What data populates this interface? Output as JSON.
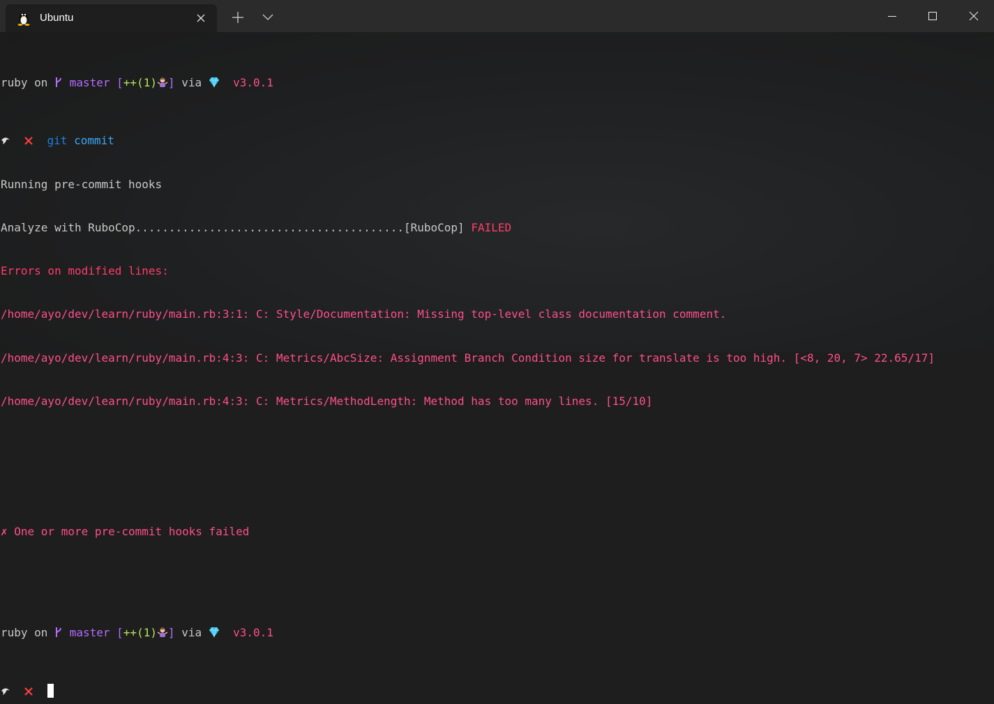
{
  "window": {
    "tab_title": "Ubuntu",
    "tab_icon": "linux-penguin-icon",
    "new_tab_icon": "plus-icon",
    "dropdown_icon": "chevron-down-icon"
  },
  "prompt": {
    "dir": "ruby",
    "on": "on",
    "branch_icon": "git-branch-icon",
    "branch": "master",
    "status_open": "[",
    "status_plus": "++(1)",
    "status_close": "]",
    "status_emoji": "person-shrugging-emoji",
    "via": "via",
    "ruby_icon": "ruby-gem-icon",
    "version": "v3.0.1",
    "shell_icon": "shell-icon",
    "error_icon": "cross-mark-icon"
  },
  "command": {
    "git": "git",
    "commit": "commit"
  },
  "output": {
    "running": "Running pre-commit hooks",
    "analyze": "Analyze with RuboCop........................................",
    "analyze_tag": "[RuboCop]",
    "failed": "FAILED",
    "errors_header": "Errors on modified lines:",
    "error_lines": [
      "/home/ayo/dev/learn/ruby/main.rb:3:1: C: Style/Documentation: Missing top-level class documentation comment.",
      "/home/ayo/dev/learn/ruby/main.rb:4:3: C: Metrics/AbcSize: Assignment Branch Condition size for translate is too high. [<8, 20, 7> 22.65/17]",
      "/home/ayo/dev/learn/ruby/main.rb:4:3: C: Metrics/MethodLength: Method has too many lines. [15/10]"
    ],
    "hooks_failed": "✗ One or more pre-commit hooks failed"
  },
  "colors": {
    "background": "#1e1e1e",
    "titlebar": "#2b2b2b",
    "branch": "#b56dff",
    "status": "#b6e35d",
    "error": "#ff4f8a",
    "git_command": "#2f8cf0"
  }
}
